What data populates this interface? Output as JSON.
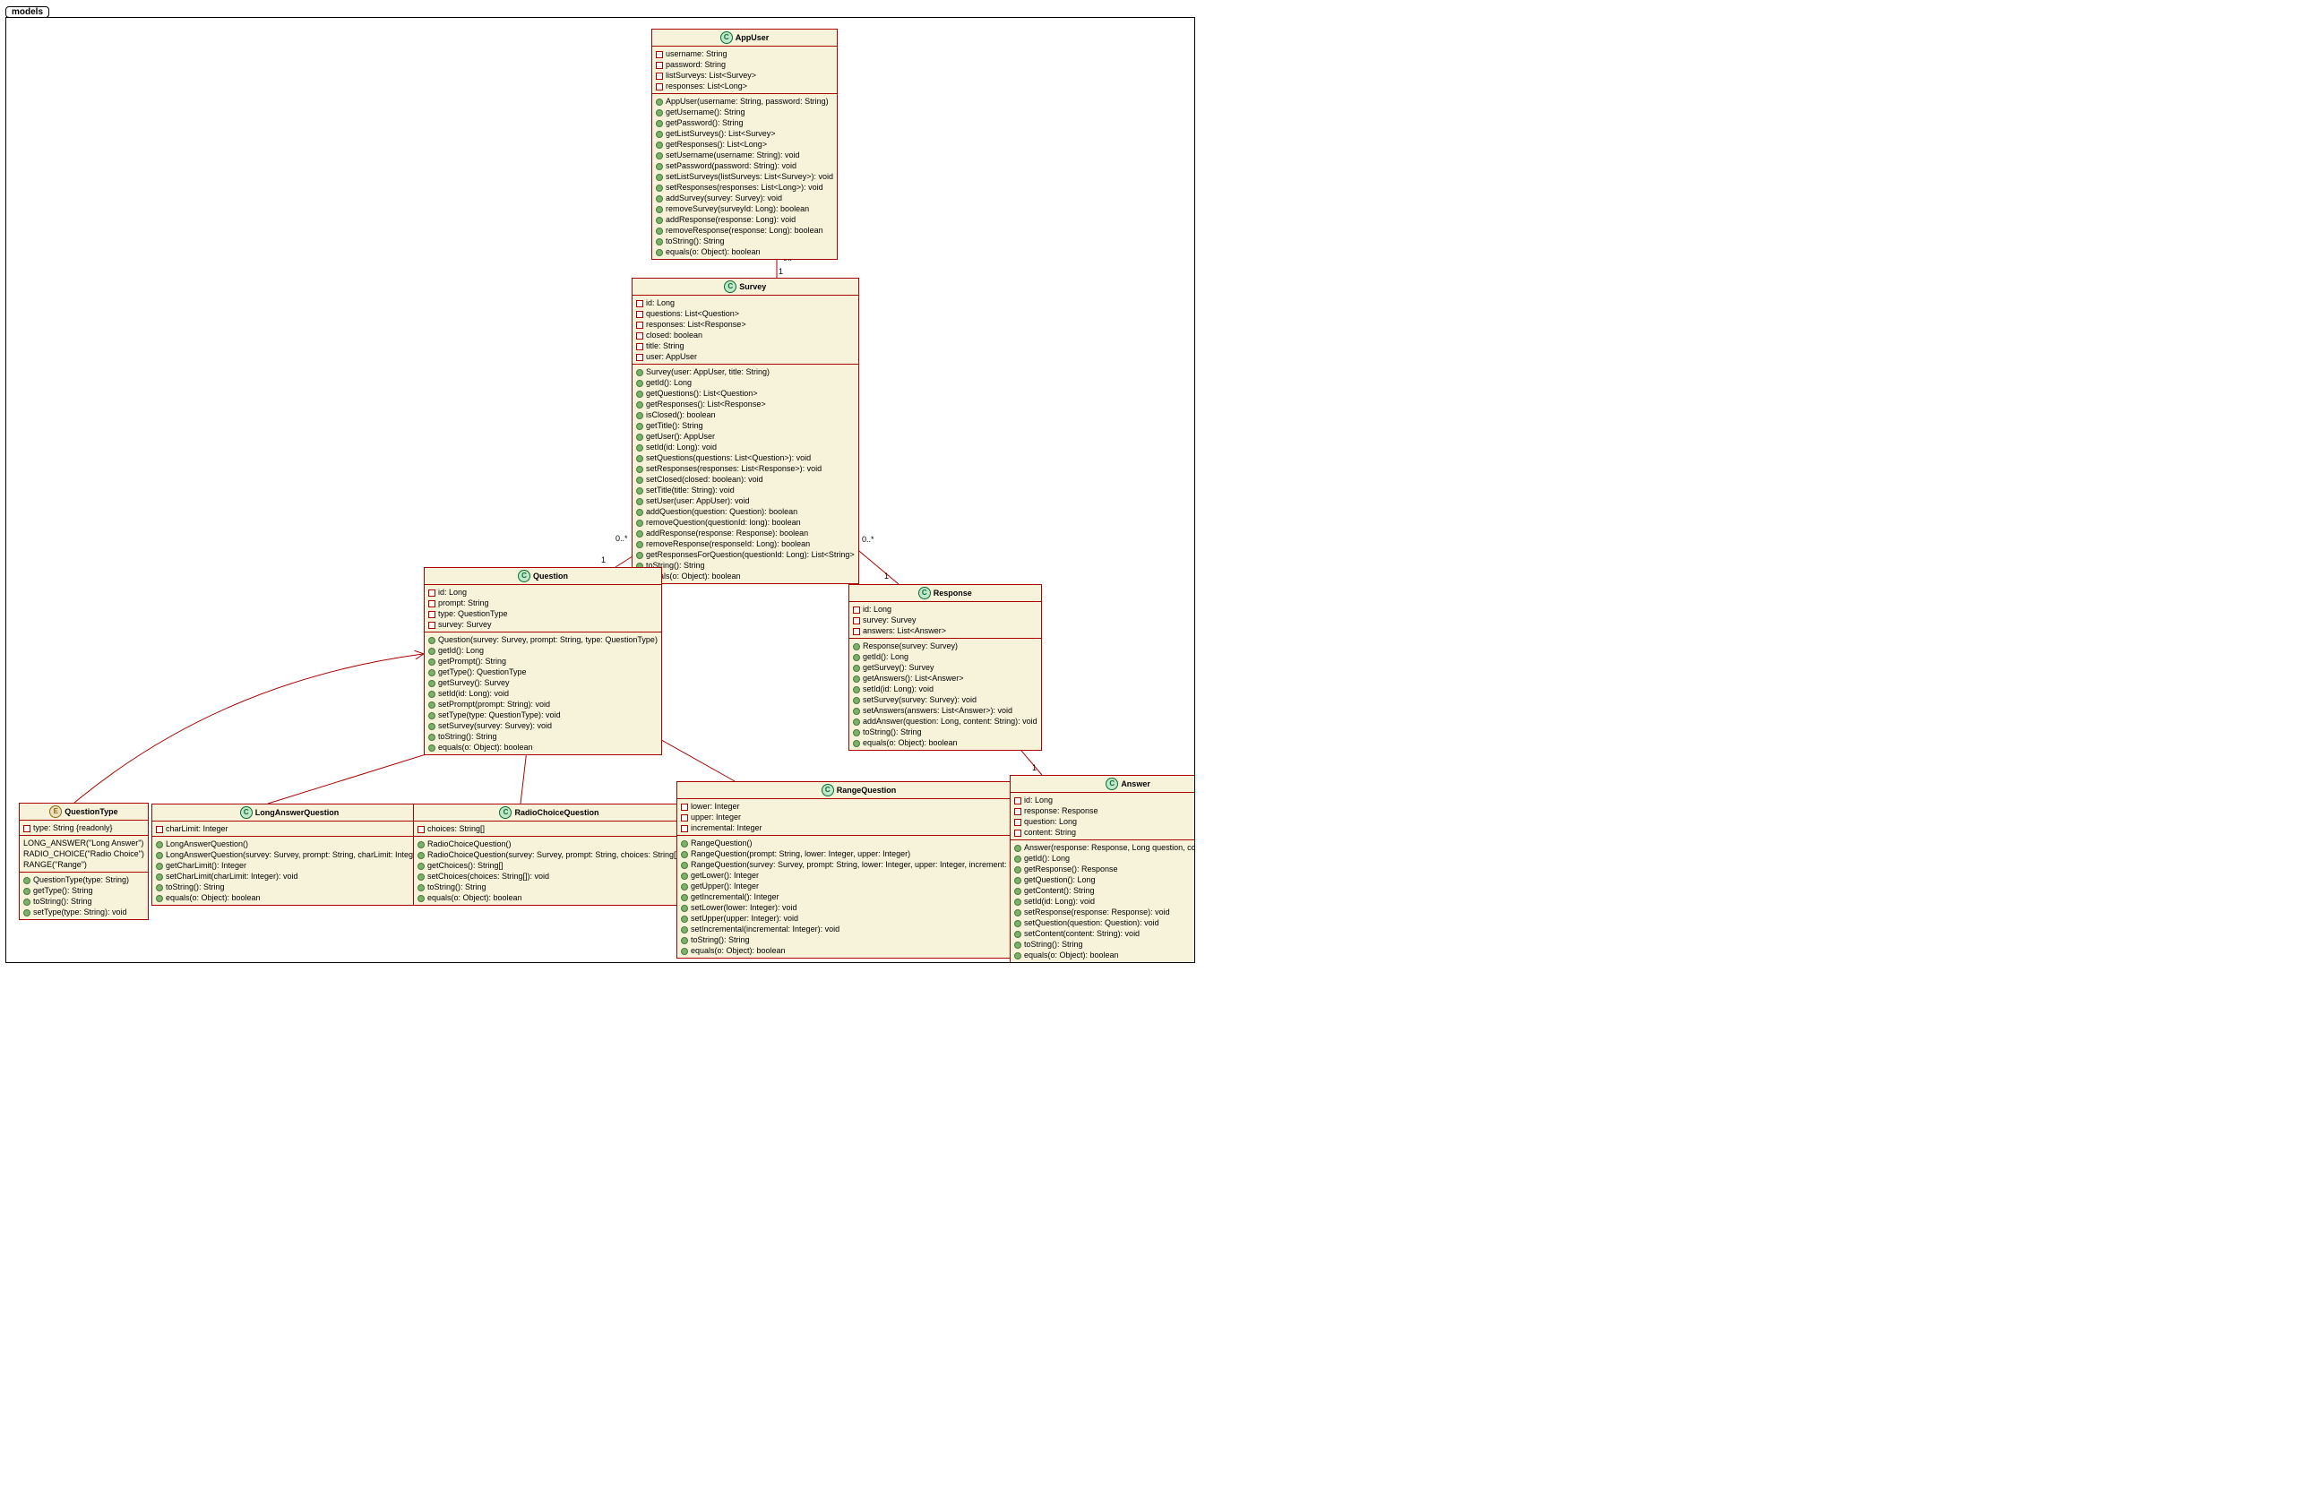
{
  "tab": "models",
  "classes": {
    "AppUser": {
      "badge": "C",
      "name": "AppUser",
      "fields": [
        "username: String",
        "password: String",
        "listSurveys: List<Survey>",
        "responses: List<Long>"
      ],
      "methods": [
        "AppUser(username: String, password: String)",
        "getUsername(): String",
        "getPassword(): String",
        "getListSurveys(): List<Survey>",
        "getResponses(): List<Long>",
        "setUsername(username: String): void",
        "setPassword(password: String): void",
        "setListSurveys(listSurveys: List<Survey>): void",
        "setResponses(responses: List<Long>): void",
        "addSurvey(survey: Survey): void",
        "removeSurvey(surveyId: Long): boolean",
        "addResponse(response: Long): void",
        "removeResponse(response: Long): boolean",
        "toString(): String",
        "equals(o: Object): boolean"
      ]
    },
    "Survey": {
      "badge": "C",
      "name": "Survey",
      "fields": [
        "id: Long",
        "questions: List<Question>",
        "responses: List<Response>",
        "closed: boolean",
        "title: String",
        "user: AppUser"
      ],
      "methods": [
        "Survey(user: AppUser, title: String)",
        "getId(): Long",
        "getQuestions(): List<Question>",
        "getResponses(): List<Response>",
        "isClosed(): boolean",
        "getTitle(): String",
        "getUser(): AppUser",
        "setId(id: Long): void",
        "setQuestions(questions: List<Question>): void",
        "setResponses(responses: List<Response>): void",
        "setClosed(closed: boolean): void",
        "setTitle(title: String): void",
        "setUser(user: AppUser): void",
        "addQuestion(question: Question): boolean",
        "removeQuestion(questionId: long): boolean",
        "addResponse(response: Response): boolean",
        "removeResponse(responseId: Long): boolean",
        "getResponsesForQuestion(questionId: Long): List<String>",
        "toString(): String",
        "equals(o: Object): boolean"
      ]
    },
    "Question": {
      "badge": "C",
      "name": "Question",
      "fields": [
        "id: Long",
        "prompt: String",
        "type: QuestionType",
        "survey: Survey"
      ],
      "methods": [
        "Question(survey: Survey, prompt: String, type: QuestionType)",
        "getId(): Long",
        "getPrompt(): String",
        "getType(): QuestionType",
        "getSurvey(): Survey",
        "setId(id: Long): void",
        "setPrompt(prompt: String): void",
        "setType(type: QuestionType): void",
        "setSurvey(survey: Survey): void",
        "toString(): String",
        "equals(o: Object): boolean"
      ]
    },
    "Response": {
      "badge": "C",
      "name": "Response",
      "fields": [
        "id: Long",
        "survey: Survey",
        "answers: List<Answer>"
      ],
      "methods": [
        "Response(survey: Survey)",
        "getId(): Long",
        "getSurvey(): Survey",
        "getAnswers(): List<Answer>",
        "setId(id: Long): void",
        "setSurvey(survey: Survey): void",
        "setAnswers(answers: List<Answer>): void",
        "addAnswer(question: Long, content: String): void",
        "toString(): String",
        "equals(o: Object): boolean"
      ]
    },
    "QuestionType": {
      "badge": "E",
      "name": "QuestionType",
      "fields": [
        "type: String {readonly}"
      ],
      "literals": [
        "LONG_ANSWER(\"Long Answer\")",
        "RADIO_CHOICE(\"Radio Choice\")",
        "RANGE(\"Range\")"
      ],
      "methods": [
        "QuestionType(type: String)",
        "getType(): String",
        "toString(): String",
        "setType(type: String): void"
      ]
    },
    "LongAnswerQuestion": {
      "badge": "C",
      "name": "LongAnswerQuestion",
      "fields": [
        "charLimit: Integer"
      ],
      "methods": [
        "LongAnswerQuestion()",
        "LongAnswerQuestion(survey: Survey, prompt: String, charLimit: Integer)",
        "getCharLimit(): Integer",
        "setCharLimit(charLimit: Integer): void",
        "toString(): String",
        "equals(o: Object): boolean"
      ]
    },
    "RadioChoiceQuestion": {
      "badge": "C",
      "name": "RadioChoiceQuestion",
      "fields": [
        "choices: String[]"
      ],
      "methods": [
        "RadioChoiceQuestion()",
        "RadioChoiceQuestion(survey: Survey, prompt: String, choices: String[])",
        "getChoices(): String[]",
        "setChoices(choices: String[]): void",
        "toString(): String",
        "equals(o: Object): boolean"
      ]
    },
    "RangeQuestion": {
      "badge": "C",
      "name": "RangeQuestion",
      "fields": [
        "lower: Integer",
        "upper: Integer",
        "incremental: Integer"
      ],
      "methods": [
        "RangeQuestion()",
        "RangeQuestion(prompt: String, lower: Integer, upper: Integer)",
        "RangeQuestion(survey: Survey, prompt: String, lower: Integer, upper: Integer, increment: Integer)",
        "getLower(): Integer",
        "getUpper(): Integer",
        "getIncremental(): Integer",
        "setLower(lower: Integer): void",
        "setUpper(upper: Integer): void",
        "setIncremental(incremental: Integer): void",
        "toString(): String",
        "equals(o: Object): boolean"
      ]
    },
    "Answer": {
      "badge": "C",
      "name": "Answer",
      "fields": [
        "id: Long",
        "response: Response",
        "question: Long",
        "content: String"
      ],
      "methods": [
        "Answer(response: Response, Long question, content: String)",
        "getId(): Long",
        "getResponse(): Response",
        "getQuestion(): Long",
        "getContent(): String",
        "setId(id: Long): void",
        "setResponse(response: Response): void",
        "setQuestion(question: Question): void",
        "setContent(content: String): void",
        "toString(): String",
        "equals(o: Object): boolean"
      ]
    }
  },
  "mults": {
    "m1": "0..*",
    "m2": "1",
    "m3": "0..*",
    "m4": "1",
    "m5": "0..*",
    "m6": "1",
    "m7": "0..*",
    "m8": "1"
  }
}
